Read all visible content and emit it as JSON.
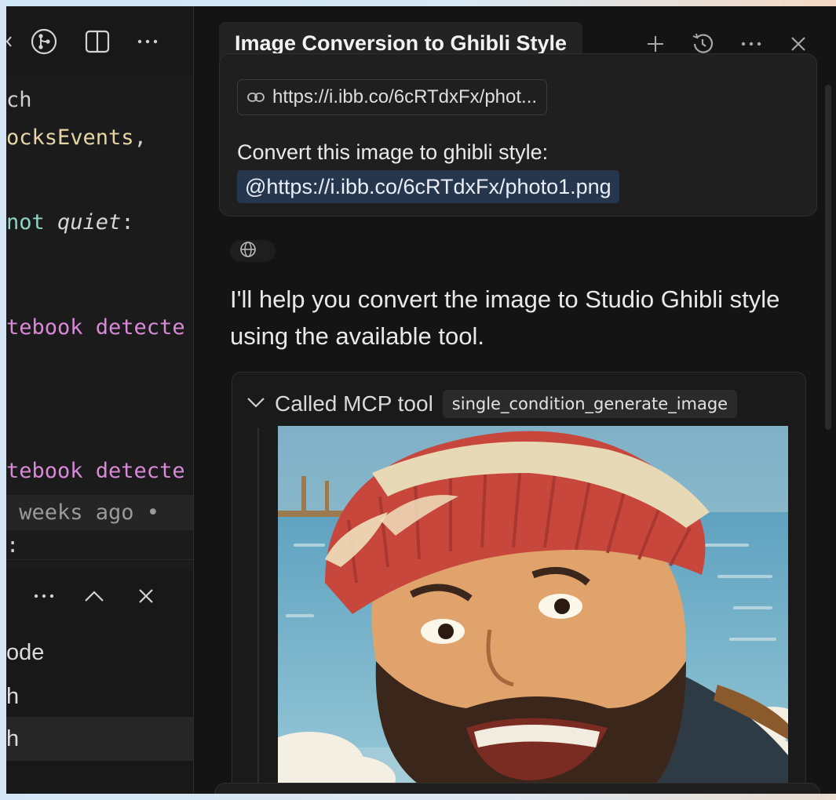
{
  "editor": {
    "code_lines": [
      {
        "segments": [
          {
            "text": "ch",
            "style": "plain"
          }
        ]
      },
      {
        "segments": [
          {
            "text": "ocksEvents",
            "style": "yellow"
          },
          {
            "text": ",",
            "style": "plain"
          }
        ]
      },
      {
        "segments": [
          {
            "text": "not ",
            "style": "teal"
          },
          {
            "text": "quiet",
            "style": "italic"
          },
          {
            "text": ":",
            "style": "plain"
          }
        ]
      },
      {
        "segments": [
          {
            "text": "tebook detecte",
            "style": "pink"
          }
        ]
      },
      {
        "segments": [
          {
            "text": "tebook detecte",
            "style": "pink"
          }
        ]
      },
      {
        "segments": [
          {
            "text": " weeks ago •",
            "style": "blame"
          }
        ]
      },
      {
        "segments": [
          {
            "text": ":",
            "style": "plain"
          }
        ]
      }
    ],
    "terminal_items": [
      {
        "label": "ode",
        "selected": false
      },
      {
        "label": "h",
        "selected": false
      },
      {
        "label": "h",
        "selected": true
      }
    ]
  },
  "chat": {
    "tab_title": "Image Conversion to Ghibli Style",
    "user_message": {
      "attachment_label": "https://i.ibb.co/6cRTdxFx/phot...",
      "text": "Convert this image to ghibli style:",
      "mention": "@https://i.ibb.co/6cRTdxFx/photo1.png"
    },
    "assistant_text": "I'll help you convert the image to Studio Ghibli style using the available tool.",
    "tool_call": {
      "title": "Called MCP tool",
      "tool_name": "single_condition_generate_image"
    }
  },
  "icons": {
    "left_toolbar": [
      "chevron-left-icon",
      "source-control-icon",
      "split-editor-icon",
      "more-icon"
    ],
    "panel_bar": [
      "more-icon",
      "chevron-up-icon",
      "close-icon"
    ],
    "header": [
      "plus-icon",
      "history-icon",
      "more-icon",
      "close-icon"
    ],
    "link_chip": "link-icon",
    "globe_chip": "globe-icon",
    "tool_toggle": "chevron-down-icon"
  },
  "colors": {
    "accent_mention_bg": "#26364d",
    "syntax_pink": "#d88ad7",
    "syntax_yellow": "#e5d6a5",
    "syntax_teal": "#8fd3c5"
  }
}
